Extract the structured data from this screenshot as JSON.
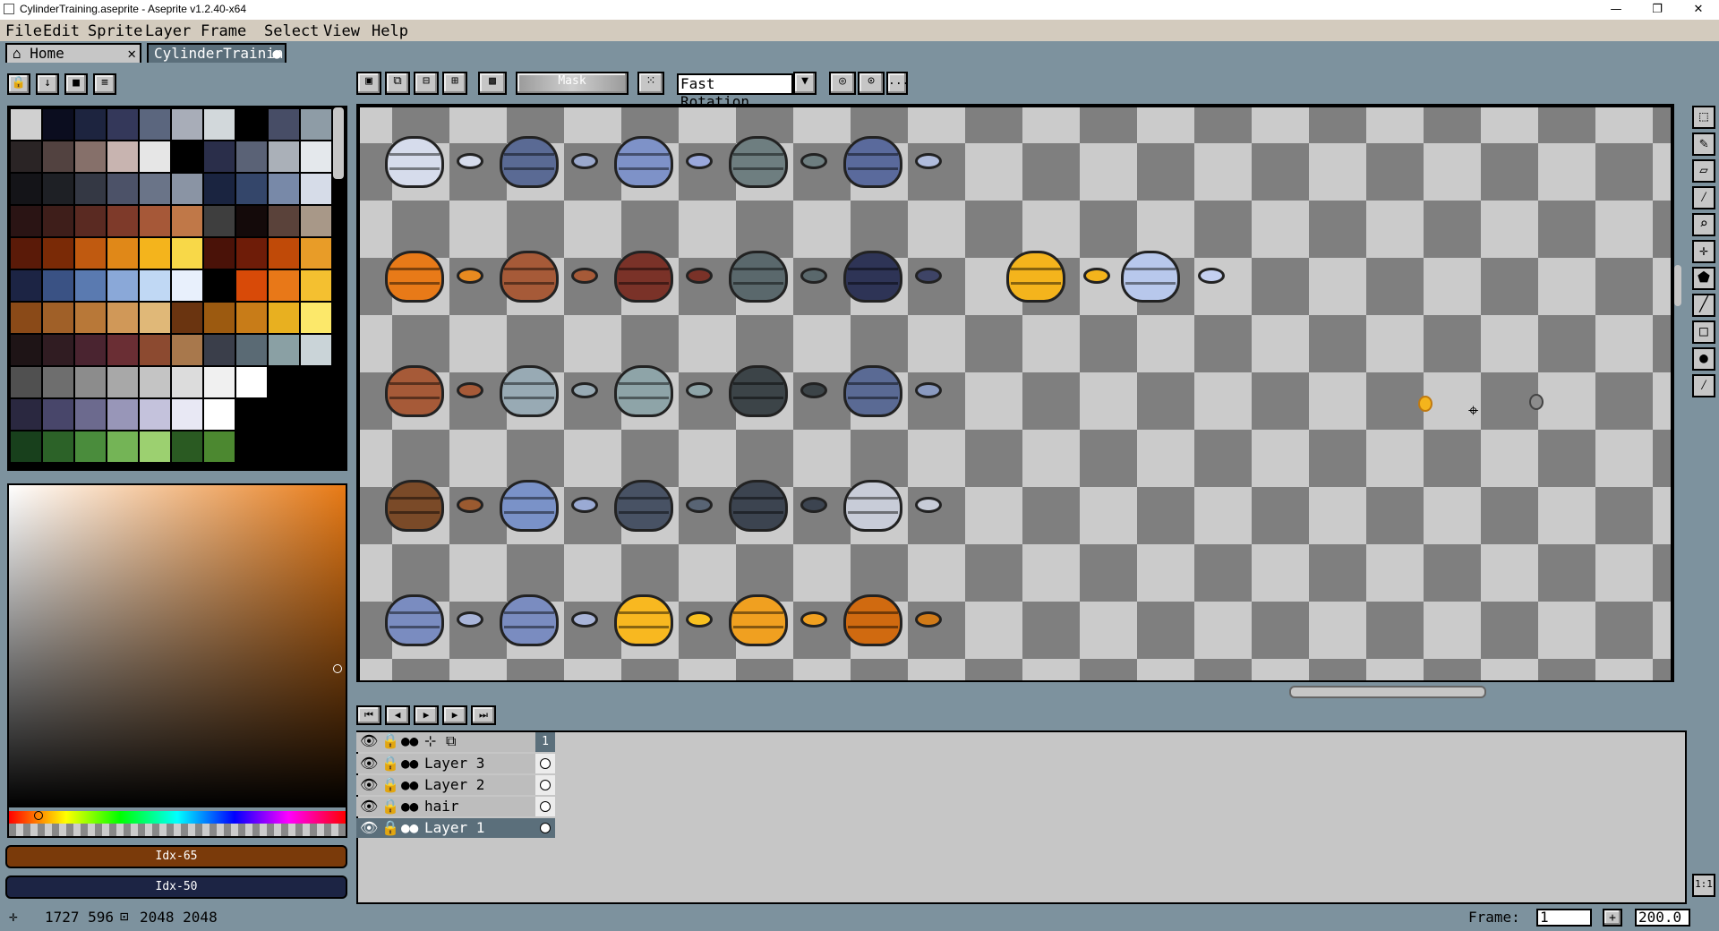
{
  "window": {
    "title": "CylinderTraining.aseprite - Aseprite v1.2.40-x64",
    "minimize": "—",
    "maximize": "❐",
    "close": "✕"
  },
  "menu": [
    "File",
    "Edit",
    "Sprite",
    "Layer",
    "Frame",
    "Select",
    "View",
    "Help"
  ],
  "tabs": [
    {
      "label": "Home",
      "close": "✕"
    },
    {
      "label": "CylinderTrainin",
      "dot": "●"
    }
  ],
  "palette_tools": [
    "lock",
    "arrow-down",
    "square",
    "menu"
  ],
  "palette_colors": [
    "#d0d0d0",
    "#0b0d1f",
    "#1d243f",
    "#34385a",
    "#5b667e",
    "#a8adb8",
    "#d2d8db",
    "#000000",
    "#474d66",
    "#8e9ca6",
    "#2a2425",
    "#524240",
    "#86706a",
    "#c8b4b0",
    "#e6e6e6",
    "#000000",
    "#2a2e4a",
    "#5a6276",
    "#aab0b8",
    "#e4e8ec",
    "#141418",
    "#1e2025",
    "#343844",
    "#4c5268",
    "#6a7488",
    "#8a94a4",
    "#1a2440",
    "#34466a",
    "#7889a8",
    "#d6dce8",
    "#2a1414",
    "#3e1e1a",
    "#5a2a22",
    "#7e3a2a",
    "#a65838",
    "#c07848",
    "#3e3e3e",
    "#140a0a",
    "#5a423a",
    "#a89888",
    "#5a1a08",
    "#7a2a06",
    "#c05a10",
    "#e08818",
    "#f4b41c",
    "#f8d848",
    "#4a1208",
    "#6e1c08",
    "#c04a08",
    "#e89c28",
    "#1c2444",
    "#3a5284",
    "#5a7ab0",
    "#8aa8d8",
    "#c0d8f4",
    "#e8f0fc",
    "#000000",
    "#d84a08",
    "#e87818",
    "#f4c030",
    "#8a4a18",
    "#a06028",
    "#b87838",
    "#d09858",
    "#e0b878",
    "#6a3410",
    "#9c5a10",
    "#c87c18",
    "#e8b020",
    "#fce86a",
    "#1e1416",
    "#301c22",
    "#4a2430",
    "#6a2e34",
    "#8c4a30",
    "#a8784c",
    "#3a3e4a",
    "#5a6a74",
    "#8aa0a4",
    "#cad4d8",
    "#505050",
    "#6e6e6e",
    "#8c8c8c",
    "#a8a8a8",
    "#c4c4c4",
    "#dcdcdc",
    "#f0f0f0",
    "#ffffff",
    "#000000",
    "#000000",
    "#2a2840",
    "#48466a",
    "#6c6a8e",
    "#9896b8",
    "#c4c2dc",
    "#e8e8f4",
    "#ffffff",
    "#000000",
    "#000000",
    "#000000",
    "#18401c",
    "#2c6228",
    "#4a8c3c",
    "#74b456",
    "#9cd070",
    "#2a5a22",
    "#4c8830",
    "#000000",
    "#000000",
    "#000000"
  ],
  "foreground": {
    "label": "Idx-65",
    "color": "#7a3a0a"
  },
  "background": {
    "label": "Idx-50",
    "color": "#1c2444"
  },
  "toolbar": {
    "mask_label": "Mask",
    "rotation_select": "Fast Rotation",
    "more": "..."
  },
  "canvas_objects": [
    {
      "kind": "barrel",
      "col": 0,
      "row": 0,
      "color": "#d6dcec"
    },
    {
      "kind": "disc",
      "col": 1,
      "row": 0,
      "color": "#d6dcec"
    },
    {
      "kind": "barrel",
      "col": 2,
      "row": 0,
      "color": "#5a6a94"
    },
    {
      "kind": "disc",
      "col": 3,
      "row": 0,
      "color": "#9aa8cc"
    },
    {
      "kind": "barrel",
      "col": 4,
      "row": 0,
      "color": "#7e92c8"
    },
    {
      "kind": "disc",
      "col": 5,
      "row": 0,
      "color": "#9aa8dc"
    },
    {
      "kind": "barrel",
      "col": 6,
      "row": 0,
      "color": "#6e7e80"
    },
    {
      "kind": "disc",
      "col": 7,
      "row": 0,
      "color": "#6e7e80"
    },
    {
      "kind": "barrel",
      "col": 8,
      "row": 0,
      "color": "#5a6a9c"
    },
    {
      "kind": "disc",
      "col": 9,
      "row": 0,
      "color": "#b0bcdc"
    },
    {
      "kind": "barrel",
      "col": 0,
      "row": 1,
      "color": "#e87a18"
    },
    {
      "kind": "disc",
      "col": 1,
      "row": 1,
      "color": "#e88a20"
    },
    {
      "kind": "barrel",
      "col": 2,
      "row": 1,
      "color": "#a65a38"
    },
    {
      "kind": "disc",
      "col": 3,
      "row": 1,
      "color": "#a65a38"
    },
    {
      "kind": "barrel",
      "col": 4,
      "row": 1,
      "color": "#7a3228"
    },
    {
      "kind": "disc",
      "col": 5,
      "row": 1,
      "color": "#7a3228"
    },
    {
      "kind": "barrel",
      "col": 6,
      "row": 1,
      "color": "#5a686c"
    },
    {
      "kind": "disc",
      "col": 7,
      "row": 1,
      "color": "#5a686c"
    },
    {
      "kind": "barrel",
      "col": 8,
      "row": 1,
      "color": "#2e3456"
    },
    {
      "kind": "disc",
      "col": 9,
      "row": 1,
      "color": "#3e4466"
    },
    {
      "kind": "barrel",
      "col": 11,
      "row": 1,
      "color": "#f4b41c"
    },
    {
      "kind": "disc",
      "col": 12,
      "row": 1,
      "color": "#f4b41c"
    },
    {
      "kind": "barrel",
      "col": 13,
      "row": 1,
      "color": "#b8c8ec"
    },
    {
      "kind": "disc",
      "col": 14,
      "row": 1,
      "color": "#c4d0f0"
    },
    {
      "kind": "barrel",
      "col": 0,
      "row": 2,
      "color": "#a65a38"
    },
    {
      "kind": "disc",
      "col": 1,
      "row": 2,
      "color": "#a65a38"
    },
    {
      "kind": "barrel",
      "col": 2,
      "row": 2,
      "color": "#98aab4"
    },
    {
      "kind": "disc",
      "col": 3,
      "row": 2,
      "color": "#98aab4"
    },
    {
      "kind": "barrel",
      "col": 4,
      "row": 2,
      "color": "#8ea4a8"
    },
    {
      "kind": "disc",
      "col": 5,
      "row": 2,
      "color": "#8ea4a8"
    },
    {
      "kind": "barrel",
      "col": 6,
      "row": 2,
      "color": "#3c4448"
    },
    {
      "kind": "disc",
      "col": 7,
      "row": 2,
      "color": "#3c4448"
    },
    {
      "kind": "barrel",
      "col": 8,
      "row": 2,
      "color": "#5a6a94"
    },
    {
      "kind": "disc",
      "col": 9,
      "row": 2,
      "color": "#8a9ac0"
    },
    {
      "kind": "barrel",
      "col": 0,
      "row": 3,
      "color": "#7a4a28"
    },
    {
      "kind": "disc",
      "col": 1,
      "row": 3,
      "color": "#9a5a30"
    },
    {
      "kind": "barrel",
      "col": 2,
      "row": 3,
      "color": "#7a92c8"
    },
    {
      "kind": "disc",
      "col": 3,
      "row": 3,
      "color": "#9aaad4"
    },
    {
      "kind": "barrel",
      "col": 4,
      "row": 3,
      "color": "#485264"
    },
    {
      "kind": "disc",
      "col": 5,
      "row": 3,
      "color": "#586474"
    },
    {
      "kind": "barrel",
      "col": 6,
      "row": 3,
      "color": "#3c4450"
    },
    {
      "kind": "disc",
      "col": 7,
      "row": 3,
      "color": "#3c4450"
    },
    {
      "kind": "barrel",
      "col": 8,
      "row": 3,
      "color": "#c8ccd8"
    },
    {
      "kind": "disc",
      "col": 9,
      "row": 3,
      "color": "#c8ccd8"
    },
    {
      "kind": "barrel",
      "col": 0,
      "row": 4,
      "color": "#7a8cc0"
    },
    {
      "kind": "disc",
      "col": 1,
      "row": 4,
      "color": "#a8b4d8"
    },
    {
      "kind": "barrel",
      "col": 2,
      "row": 4,
      "color": "#7a8cc0"
    },
    {
      "kind": "disc",
      "col": 3,
      "row": 4,
      "color": "#a8b4d8"
    },
    {
      "kind": "barrel",
      "col": 4,
      "row": 4,
      "color": "#f8b820"
    },
    {
      "kind": "disc",
      "col": 5,
      "row": 4,
      "color": "#f8c020"
    },
    {
      "kind": "barrel",
      "col": 6,
      "row": 4,
      "color": "#f0a020"
    },
    {
      "kind": "disc",
      "col": 7,
      "row": 4,
      "color": "#f0a020"
    },
    {
      "kind": "barrel",
      "col": 8,
      "row": 4,
      "color": "#d06a10"
    },
    {
      "kind": "disc",
      "col": 9,
      "row": 4,
      "color": "#d07a18"
    }
  ],
  "playback": [
    "first-frame",
    "prev-frame",
    "play",
    "next-frame",
    "last-frame"
  ],
  "layers": [
    {
      "name": "Layer 3",
      "selected": false
    },
    {
      "name": "Layer 2",
      "selected": false
    },
    {
      "name": "hair",
      "selected": false
    },
    {
      "name": "Layer 1",
      "selected": true
    }
  ],
  "frame_header": "1",
  "status": {
    "cursor": "1727 596",
    "size": "2048 2048",
    "frame_label": "Frame:",
    "frame_value": "1",
    "add_frame": "+",
    "zoom": "200.0"
  },
  "right_tools": [
    "marquee",
    "pencil",
    "eraser",
    "eyedropper",
    "zoom",
    "move",
    "bucket",
    "line",
    "rectangle",
    "ellipse",
    "blur"
  ],
  "ratio_label": "1:1"
}
